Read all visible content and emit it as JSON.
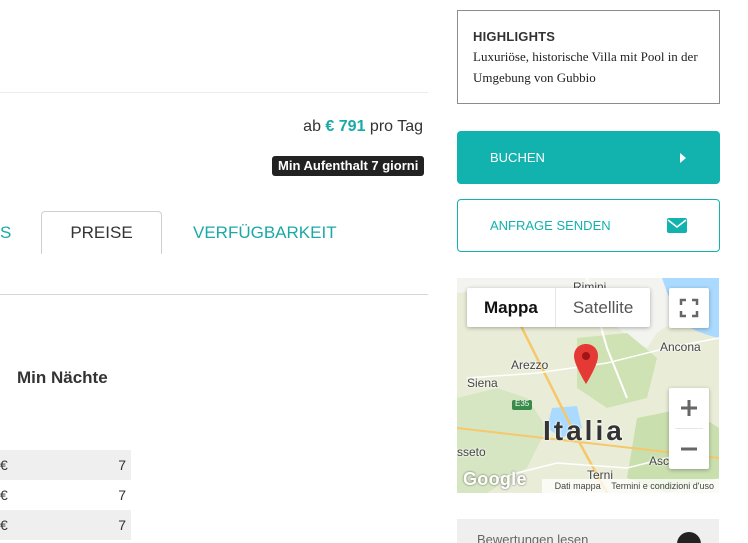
{
  "listing": {
    "price_prefix": "ab",
    "price_amount": "€ 791",
    "price_suffix": "pro Tag",
    "min_stay_badge": "Min Aufenthalt 7 giorni"
  },
  "tabs": {
    "partial_label": "S",
    "active_label": "PREISE",
    "availability_label": "VERFÜGBARKEIT"
  },
  "price_table": {
    "column_header": "Min Nächte",
    "rows": [
      {
        "currency": "€",
        "min_nights": "7"
      },
      {
        "currency": "€",
        "min_nights": "7"
      },
      {
        "currency": "€",
        "min_nights": "7"
      }
    ]
  },
  "highlights": {
    "title": "HIGHLIGHTS",
    "text": "Luxuriöse, historische Villa mit Pool in der Umgebung von Gubbio"
  },
  "actions": {
    "book_label": "BUCHEN",
    "inquiry_label": "ANFRAGE SENDEN"
  },
  "map": {
    "type_map": "Mappa",
    "type_satellite": "Satellite",
    "places": [
      "Rimini",
      "Ancona",
      "Arezzo",
      "Siena",
      "Italia",
      "sseto",
      "Terni",
      "Asc"
    ],
    "road_label": "E35",
    "logo": "Google",
    "footer_data": "Dati mappa",
    "footer_terms": "Termini e condizioni d'uso",
    "icons": [
      "fullscreen-icon",
      "zoom-in-icon",
      "zoom-out-icon",
      "map-pin-icon"
    ]
  },
  "reviews": {
    "label": "Bewertungen lesen"
  },
  "colors": {
    "accent": "#12b2ae",
    "badge": "#222222",
    "pin": "#e53935"
  }
}
